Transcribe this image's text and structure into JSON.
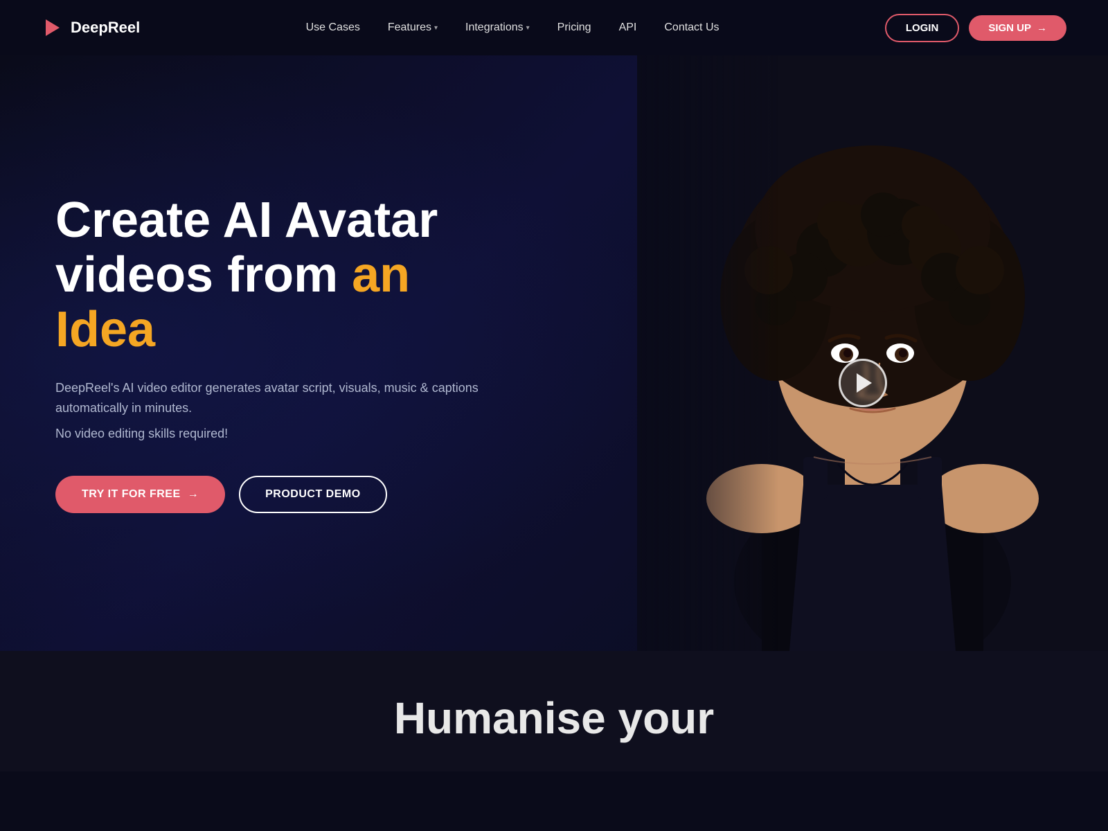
{
  "brand": {
    "name": "DeepReel",
    "logo_icon": "▶"
  },
  "nav": {
    "links": [
      {
        "label": "Use Cases",
        "has_dropdown": false
      },
      {
        "label": "Features",
        "has_dropdown": true
      },
      {
        "label": "Integrations",
        "has_dropdown": true
      },
      {
        "label": "Pricing",
        "has_dropdown": false
      },
      {
        "label": "API",
        "has_dropdown": false
      },
      {
        "label": "Contact Us",
        "has_dropdown": false
      }
    ],
    "login_label": "LOGIN",
    "signup_label": "SIGN UP",
    "signup_arrow": "→"
  },
  "hero": {
    "title_line1": "Create AI Avatar",
    "title_line2_plain": "videos from ",
    "title_line2_highlight": "an Idea",
    "description": "DeepReel's AI video editor generates avatar script, visuals, music & captions automatically in minutes.",
    "subtext": "No video editing skills required!",
    "try_button": "TRY IT FOR FREE",
    "try_arrow": "→",
    "demo_button": "PRODUCT DEMO"
  },
  "bottom": {
    "heading": "Humanise your"
  },
  "colors": {
    "accent": "#e05a6a",
    "highlight": "#f5a623",
    "bg_dark": "#0a0b1a",
    "bg_mid": "#0f1035",
    "text_muted": "#b0b8d0"
  }
}
